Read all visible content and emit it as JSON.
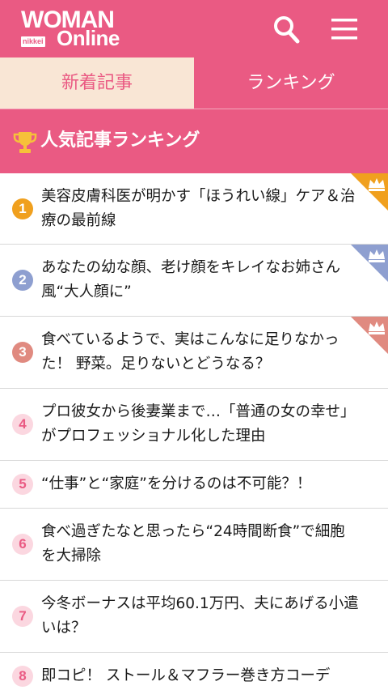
{
  "header": {
    "logo_top": "WOMAN",
    "logo_bottom": "Online",
    "logo_badge": "nikkei",
    "search_icon": "search-icon",
    "menu_icon": "hamburger-menu-icon"
  },
  "tabs": [
    {
      "label": "新着記事",
      "active": true
    },
    {
      "label": "ランキング",
      "active": false
    }
  ],
  "section": {
    "title": "人気記事ランキング",
    "icon": "trophy-icon"
  },
  "colors": {
    "brand": "#ea5a83",
    "tab_active_bg": "#f9e6d5",
    "gold": "#f0a01e",
    "silver": "#8e9fd0",
    "bronze": "#e08a80",
    "plain_badge": "#fbd7e0"
  },
  "ranking": [
    {
      "rank": "1",
      "title": "美容皮膚科医が明かす「ほうれい線」ケア＆治療の最前線",
      "crown": "gold"
    },
    {
      "rank": "2",
      "title": "あなたの幼な顔、老け顔をキレイなお姉さん風“大人顔に”",
      "crown": "silver"
    },
    {
      "rank": "3",
      "title": "食べているようで、実はこんなに足りなかった！ 野菜。足りないとどうなる？",
      "crown": "bronze"
    },
    {
      "rank": "4",
      "title": "プロ彼女から後妻業まで…「普通の女の幸せ」がプロフェッショナル化した理由",
      "crown": ""
    },
    {
      "rank": "5",
      "title": "“仕事”と“家庭”を分けるのは不可能？！",
      "crown": ""
    },
    {
      "rank": "6",
      "title": "食べ過ぎたなと思ったら“24時間断食”で細胞を大掃除",
      "crown": ""
    },
    {
      "rank": "7",
      "title": "今冬ボーナスは平均60.1万円、夫にあげる小遣いは？",
      "crown": ""
    },
    {
      "rank": "8",
      "title": "即コピ！ ストール＆マフラー巻き方コーデ",
      "crown": ""
    }
  ]
}
